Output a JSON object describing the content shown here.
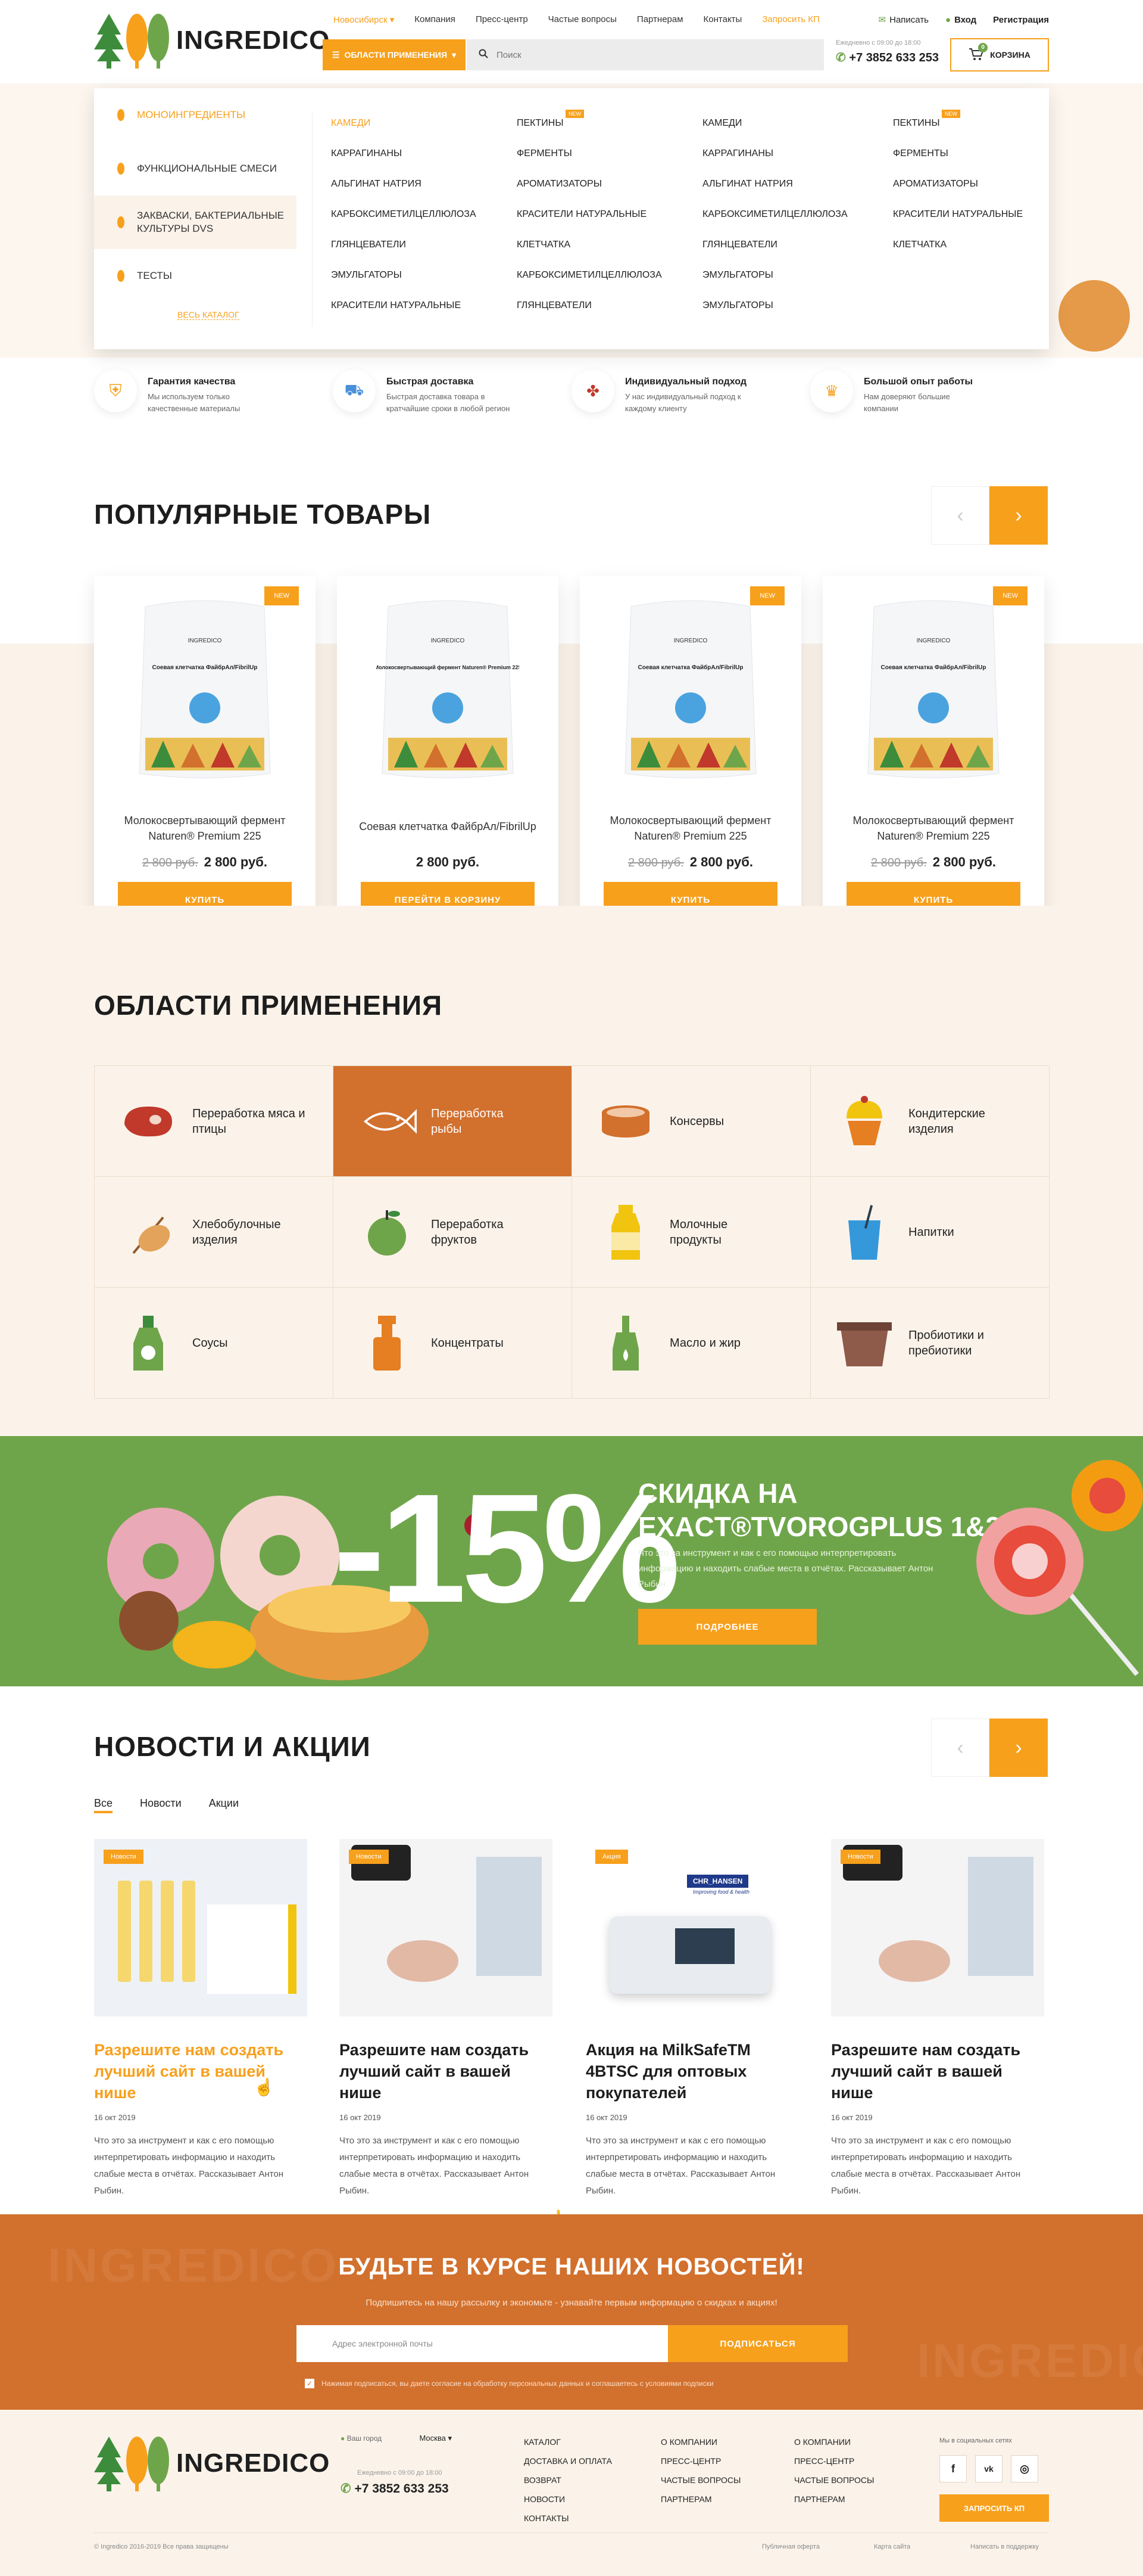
{
  "header": {
    "logo_text": "INGREDICO",
    "city": "Новосибирск",
    "nav": [
      "Компания",
      "Пресс-центр",
      "Частые вопросы",
      "Партнерам",
      "Контакты"
    ],
    "request_kp": "Запросить КП",
    "write": "Написать",
    "login": "Вход",
    "register": "Регистрация",
    "areas_button": "Области применения",
    "search_placeholder": "Поиск",
    "phone_hours": "Ежедневно с 09:00 до 18:00",
    "phone": "+7 3852 633 253",
    "cart_label": "Корзина",
    "cart_count": "0"
  },
  "mega_menu": {
    "categories": [
      "Моноингредиенты",
      "Функциональные смеси",
      "Закваски, бактериальные культуры DVS",
      "Тесты"
    ],
    "all_catalog": "Весь каталог",
    "new_tag": "NEW",
    "columns": [
      [
        "Камеди",
        "Каррагинаны",
        "Альгинат натрия",
        "Карбоксиметилцеллюлоза",
        "Глянцеватели",
        "Эмульгаторы",
        "Красители натуральные"
      ],
      [
        "Пектины",
        "Ферменты",
        "Ароматизаторы",
        "Красители натуральные",
        "Клетчатка",
        "Карбоксиметилцеллюлоза",
        "Глянцеватели"
      ],
      [
        "Камеди",
        "Каррагинаны",
        "Альгинат натрия",
        "Карбоксиметилцеллюлоза",
        "Глянцеватели",
        "Эмульгаторы",
        "Эмульгаторы"
      ],
      [
        "Пектины",
        "Ферменты",
        "Ароматизаторы",
        "Красители натуральные",
        "Клетчатка"
      ]
    ]
  },
  "features": [
    {
      "title": "Гарантия качества",
      "text": "Мы используем только качественные материалы"
    },
    {
      "title": "Быстрая доставка",
      "text": "Быстрая доставка товара в кратчайшие сроки в любой регион"
    },
    {
      "title": "Индивидуальный подход",
      "text": "У нас индивидуальный подход к каждому клиенту"
    },
    {
      "title": "Большой опыт работы",
      "text": "Нам доверяют большие компании"
    }
  ],
  "popular": {
    "title": "Популярные товары",
    "products": [
      {
        "name": "Молокосвертывающий фермент Naturen® Premium 225",
        "old_price": "2 800 руб.",
        "price": "2 800 руб.",
        "button": "Купить",
        "tag": "NEW",
        "bag_label": "Соевая клетчатка ФайбрАл/FibrilUp"
      },
      {
        "name": "Соевая клетчатка ФайбрАл/FibrilUp",
        "old_price": "",
        "price": "2 800 руб.",
        "button": "Перейти в корзину",
        "tag": "",
        "bag_label": "Молокосвертывающий фермент Naturen® Premium 225"
      },
      {
        "name": "Молокосвертывающий фермент Naturen® Premium 225",
        "old_price": "2 800 руб.",
        "price": "2 800 руб.",
        "button": "Купить",
        "tag": "NEW",
        "bag_label": "Соевая клетчатка ФайбрАл/FibrilUp"
      },
      {
        "name": "Молокосвертывающий фермент Naturen® Premium 225",
        "old_price": "2 800 руб.",
        "price": "2 800 руб.",
        "button": "Купить",
        "tag": "NEW",
        "bag_label": "Соевая клетчатка ФайбрАл/FibrilUp"
      }
    ]
  },
  "areas": {
    "title": "Области применения",
    "items": [
      {
        "label": "Переработка мяса и птицы",
        "icon": "meat-icon"
      },
      {
        "label": "Переработка рыбы",
        "icon": "fish-icon"
      },
      {
        "label": "Консервы",
        "icon": "can-icon"
      },
      {
        "label": "Кондитерские изделия",
        "icon": "cupcake-icon"
      },
      {
        "label": "Хлебобулочные изделия",
        "icon": "bread-icon"
      },
      {
        "label": "Переработка фруктов",
        "icon": "apple-icon"
      },
      {
        "label": "Молочные продукты",
        "icon": "milk-bottle-icon"
      },
      {
        "label": "Напитки",
        "icon": "drink-glass-icon"
      },
      {
        "label": "Соусы",
        "icon": "sauce-bottle-icon"
      },
      {
        "label": "Концентраты",
        "icon": "spray-bottle-icon"
      },
      {
        "label": "Масло и жир",
        "icon": "oil-bottle-icon"
      },
      {
        "label": "Пробиотики и пребиотики",
        "icon": "yogurt-cup-icon"
      }
    ]
  },
  "promo": {
    "percent": "-15%",
    "title_line1": "Скидка на",
    "title_line2": "exact®tvorogplus 1&2",
    "text": "Что это за инструмент и как с его помощью интерпретировать информацию и находить слабые места в отчётах. Рассказывает Антон Рыбин.",
    "button": "Подробнее"
  },
  "news": {
    "title": "Новости и акции",
    "tabs": [
      "Все",
      "Новости",
      "Акции"
    ],
    "items": [
      {
        "tag": "Новости",
        "title": "Разрешите нам создать лучший сайт в вашей нише",
        "date": "16 окт 2019",
        "text": "Что это за инструмент и как с его помощью интерпретировать информацию и находить слабые места в отчётах. Рассказывает Антон Рыбин."
      },
      {
        "tag": "Новости",
        "title": "Разрешите нам создать лучший сайт в вашей нише",
        "date": "16 окт 2019",
        "text": "Что это за инструмент и как с его помощью интерпретировать информацию и находить слабые места в отчётах. Рассказывает Антон Рыбин."
      },
      {
        "tag": "Акция",
        "title": "Акция на MilkSafeTM 4BTSC для оптовых покупателей",
        "date": "16 окт 2019",
        "text": "Что это за инструмент и как с его помощью интерпретировать информацию и находить слабые места в отчётах. Рассказывает Антон Рыбин."
      },
      {
        "tag": "Новости",
        "title": "Разрешите нам создать лучший сайт в вашей нише",
        "date": "16 окт 2019",
        "text": "Что это за инструмент и как с его помощью интерпретировать информацию и находить слабые места в отчётах. Рассказывает Антон Рыбин."
      }
    ],
    "brand_label": "CHR_HANSEN",
    "brand_tagline": "Improving food & health"
  },
  "subscribe": {
    "title": "Будьте в курсе наших новостей!",
    "text": "Подпишитесь на нашу рассылку и экономьте - узнавайте первым информацию о скидках и акциях!",
    "placeholder": "Адрес электронной почты",
    "button": "Подписаться",
    "agree": "Нажимая подписаться, вы даете согласие на обработку персональных данных и соглашаетесь с условиями подписки"
  },
  "footer": {
    "city_label": "Ваш город",
    "city": "Москва",
    "phone_hours": "Ежедневно с 09:00 до 18:00",
    "phone": "+7 3852 633 253",
    "col1": [
      "Каталог",
      "Доставка и оплата",
      "Возврат",
      "Новости",
      "Контакты"
    ],
    "col2": [
      "О компании",
      "Пресс-центр",
      "Частые вопросы",
      "Партнерам"
    ],
    "col3": [
      "О компании",
      "Пресс-центр",
      "Частые вопросы",
      "Партнерам"
    ],
    "social_label": "Мы в социальных сетях",
    "request_kp": "Запросить КП",
    "copyright": "© Ingredico 2016-2019 Все права защищены",
    "offer": "Публичная оферта",
    "sitemap": "Карта сайта",
    "made_by": "Написать в поддержку"
  },
  "colors": {
    "accent": "#f7a01c",
    "rust": "#d2702d",
    "green": "#6fa54a",
    "cream": "#fbf3ea"
  }
}
